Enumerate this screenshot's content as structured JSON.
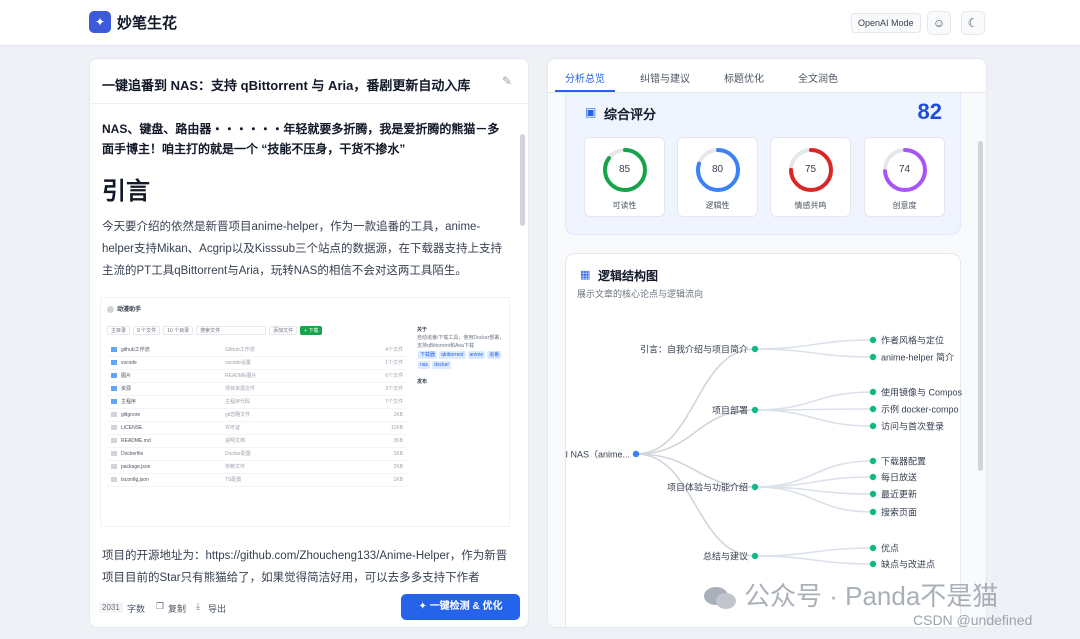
{
  "header": {
    "app_title": "妙笔生花",
    "logo_icon": "sparkle-icon",
    "mode_badge": "OpenAI Mode",
    "theme_icon": "moon-icon",
    "robot_icon": "robot-icon"
  },
  "editor": {
    "title": "一键追番到 NAS：支持 qBittorrent 与 Aria，番剧更新自动入库",
    "intro": "NAS、键盘、路由器・・・・・・年轻就要多折腾，我是爱折腾的熊猫－多面手博主！咱主打的就是一个 “技能不压身，干货不掺水”",
    "heading": "引言",
    "para1": "今天要介绍的依然是新晋项目anime-helper，作为一款追番的工具，anime-helper支持Mikan、Acgrip以及Kisssub三个站点的数据源，在下载器支持上支持主流的PT工具qBittorrent与Aria，玩转NAS的相信不会对这两工具陌生。",
    "para2": "项目的开源地址为：https://github.com/Zhoucheng133/Anime-Helper，作为新晋项目目前的Star只有熊猫给了，如果觉得简洁好用，可以去多多支持下作者",
    "embed": {
      "app_name": "动漫助手",
      "toolbar": [
        "主目录",
        "9 个文件",
        "10 个目录",
        "搜索文件",
        "添加文件",
        "+ 下载"
      ],
      "files": [
        {
          "name": "github工作流",
          "desc": "Github工作流",
          "size": "4个文件"
        },
        {
          "name": "vscode",
          "desc": "vscode设置",
          "size": "1个文件"
        },
        {
          "name": "图片",
          "desc": "README图片",
          "size": "6个文件"
        },
        {
          "name": "资源",
          "desc": "项目资源文件",
          "size": "3个文件"
        },
        {
          "name": "主程序",
          "desc": "主程序代码",
          "size": "7个文件"
        },
        {
          "name": "gitignore",
          "desc": "git忽略文件",
          "size": "1KB"
        },
        {
          "name": "LICENSE",
          "desc": "许可证",
          "size": "11KB"
        },
        {
          "name": "README.md",
          "desc": "说明文档",
          "size": "3KB"
        },
        {
          "name": "Dockerfile",
          "desc": "Docker配置",
          "size": "1KB"
        },
        {
          "name": "package.json",
          "desc": "依赖文件",
          "size": "2KB"
        },
        {
          "name": "tsconfig.json",
          "desc": "TS配置",
          "size": "1KB"
        }
      ],
      "side_title": "关于",
      "side_desc": "自动追番/下载工具，使用Docker部署，支持qBittorrent和Aria下载",
      "tags": [
        "下载器",
        "qbittorrent",
        "anime",
        "追番",
        "nas",
        "docker"
      ],
      "side_release": "发布"
    }
  },
  "editor_footer": {
    "word_count": "2031",
    "word_label": "字数",
    "copy_icon": "copy-icon",
    "copy_label": "复制",
    "export_icon": "download-icon",
    "export_label": "导出",
    "primary_icon": "sparkle-icon",
    "primary_label": "一键检测 & 优化"
  },
  "tabs": [
    "分析总览",
    "纠错与建议",
    "标题优化",
    "全文润色"
  ],
  "active_tab": 0,
  "score": {
    "title": "综合评分",
    "total": "82",
    "metrics": [
      {
        "label": "可读性",
        "value": 85,
        "color": "#16a34a"
      },
      {
        "label": "逻辑性",
        "value": 80,
        "color": "#3b82f6"
      },
      {
        "label": "情感共鸣",
        "value": 75,
        "color": "#dc2626"
      },
      {
        "label": "创意度",
        "value": 74,
        "color": "#a855f7"
      }
    ]
  },
  "logic": {
    "title": "逻辑结构图",
    "subtitle": "展示文章的核心论点与逻辑流向",
    "root": "I NAS（anime...",
    "branches": [
      {
        "label": "引言：自我介绍与项目简介",
        "children": [
          "作者风格与定位",
          "anime-helper 简介"
        ]
      },
      {
        "label": "项目部署",
        "children": [
          "使用镜像与 Compos",
          "示例 docker-compo",
          "访问与首次登录"
        ]
      },
      {
        "label": "项目体验与功能介绍",
        "children": [
          "下载器配置",
          "每日放送",
          "最近更新",
          "搜索页面"
        ]
      },
      {
        "label": "总结与建议",
        "children": [
          "优点",
          "缺点与改进点"
        ]
      }
    ]
  },
  "watermark": {
    "text": "公众号 · Panda不是猫",
    "csdn": "CSDN @undefined"
  }
}
